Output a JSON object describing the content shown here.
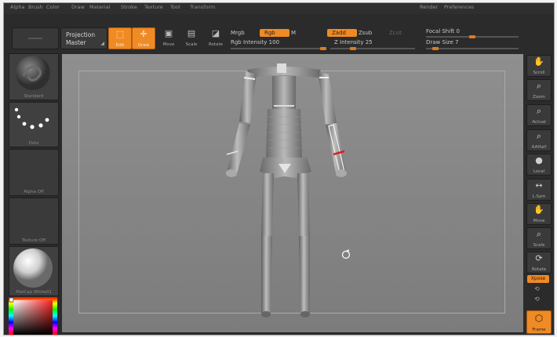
{
  "menu": [
    "Alpha",
    "Brush",
    "Color",
    "Draw",
    "Material",
    "Stroke",
    "Texture",
    "Tool",
    "Transform",
    "Render",
    "Preferences"
  ],
  "toolbar": {
    "projection_master_line1": "Projection",
    "projection_master_line2": "Master",
    "edit_label": "Edit",
    "draw_label": "Draw",
    "move_label": "Move",
    "scale_label": "Scale",
    "rotate_label": "Rotate",
    "mrgb_label": "Mrgb",
    "rgb_label": "Rgb",
    "m_label": "M",
    "rgb_intensity_label": "Rgb Intensity 100",
    "rgb_intensity_value": 100,
    "zadd_label": "Zadd",
    "zsub_label": "Zsub",
    "zcut_label": "Zcut",
    "z_intensity_label": "Z Intensity 25",
    "z_intensity_value": 25,
    "focal_shift_label": "Focal Shift 0",
    "focal_shift_value": 0,
    "draw_size_label": "Draw Size 7",
    "draw_size_value": 7
  },
  "left_shelf": {
    "brush_caption": "Standard",
    "stroke_caption": "Dots",
    "alpha_caption": "Alpha Off",
    "texture_caption": "Texture Off",
    "material_caption": "MatCap White01"
  },
  "right_shelf": {
    "scroll": "Scroll",
    "zoom": "Zoom",
    "actual": "Actual",
    "aahalf": "AAHalf",
    "local": "Local",
    "lsym": "L.Sym",
    "move": "Move",
    "scale": "Scale",
    "rotate": "Rotate",
    "xpose": "Xpose",
    "frame": "Frame"
  },
  "colors": {
    "accent": "#f08a24",
    "background": "#2b2b2b",
    "viewport": "#8a8a8a"
  }
}
